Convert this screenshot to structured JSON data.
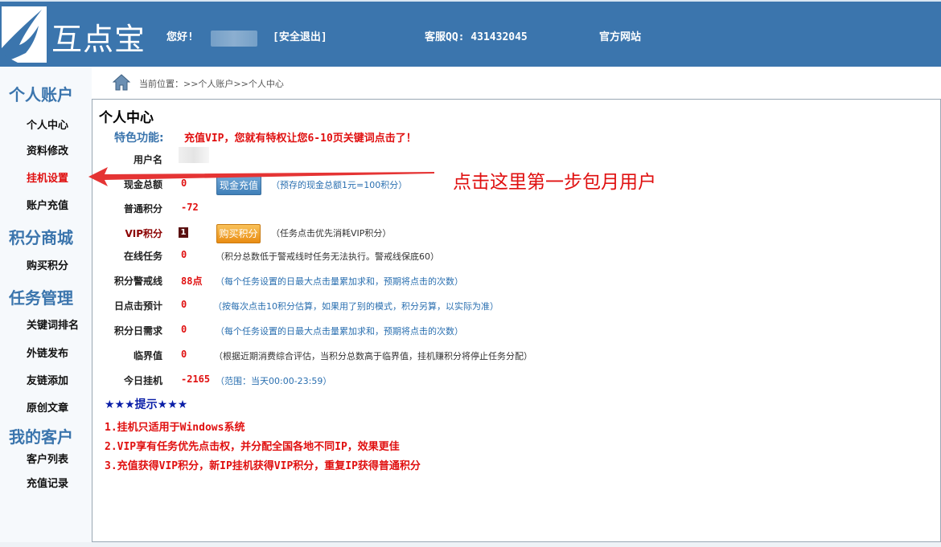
{
  "header": {
    "logo_text": "互点宝",
    "greeting": "您好!",
    "logout": "[安全退出]",
    "service": "客服QQ: 431432045",
    "official_site": "官方网站"
  },
  "sidebar": {
    "sections": [
      {
        "title": "个人账户",
        "items": [
          "个人中心",
          "资料修改",
          "挂机设置",
          "账户充值"
        ]
      },
      {
        "title": "积分商城",
        "items": [
          "购买积分"
        ]
      },
      {
        "title": "任务管理",
        "items": [
          "关键词排名",
          "外链发布",
          "友链添加",
          "原创文章"
        ]
      },
      {
        "title": "我的客户",
        "items": [
          "客户列表",
          "充值记录"
        ]
      }
    ]
  },
  "breadcrumb": "当前位置：>>个人账户>>个人中心",
  "main": {
    "title": "个人中心",
    "feature_label": "特色功能:",
    "feature_text": "充值VIP，您就有特权让您6-10页关键词点击了！",
    "rows": [
      {
        "label": "用户名",
        "value": "",
        "note": ""
      },
      {
        "label": "现金总额",
        "value": "0",
        "note": "（预存的现金总额1元=100积分）"
      },
      {
        "label": "普通积分",
        "value": "-72",
        "note": ""
      },
      {
        "label": "VIP积分",
        "value": "1",
        "note": "（任务点击优先消耗VIP积分）"
      },
      {
        "label": "在线任务",
        "value": "0",
        "note": "（积分总数低于警戒线时任务无法执行。警戒线保底60）"
      },
      {
        "label": "积分警戒线",
        "value": "88点",
        "note": "（每个任务设置的日最大点击量累加求和，预期将点击的次数）"
      },
      {
        "label": "日点击预计",
        "value": "0",
        "note": "（按每次点击10积分估算，如果用了别的模式，积分另算，以实际为准）"
      },
      {
        "label": "积分日需求",
        "value": "0",
        "note": "（每个任务设置的日最大点击量累加求和，预期将点击的次数）"
      },
      {
        "label": "临界值",
        "value": "0",
        "note": "（根据近期消费综合评估，当积分总数高于临界值，挂机赚积分将停止任务分配）"
      },
      {
        "label": "今日挂机",
        "value": "-2165",
        "note": "（范围：当天00:00-23:59）"
      }
    ],
    "buttons": {
      "cash_recharge": "现金充值",
      "buy_points": "购买积分"
    },
    "tips_title": "★★★提示★★★",
    "tips": [
      "1.挂机只适用于Windows系统",
      "2.VIP享有任务优先点击权，并分配全国各地不同IP，效果更佳",
      "3.充值获得VIP积分，新IP挂机获得VIP积分，重复IP获得普通积分"
    ]
  },
  "annotation": {
    "text": "点击这里第一步包月用户",
    "color": "#e01010"
  },
  "colors": {
    "header_bg": "#3b75ad",
    "accent_red": "#e01010",
    "section_blue": "#3b75ad"
  }
}
